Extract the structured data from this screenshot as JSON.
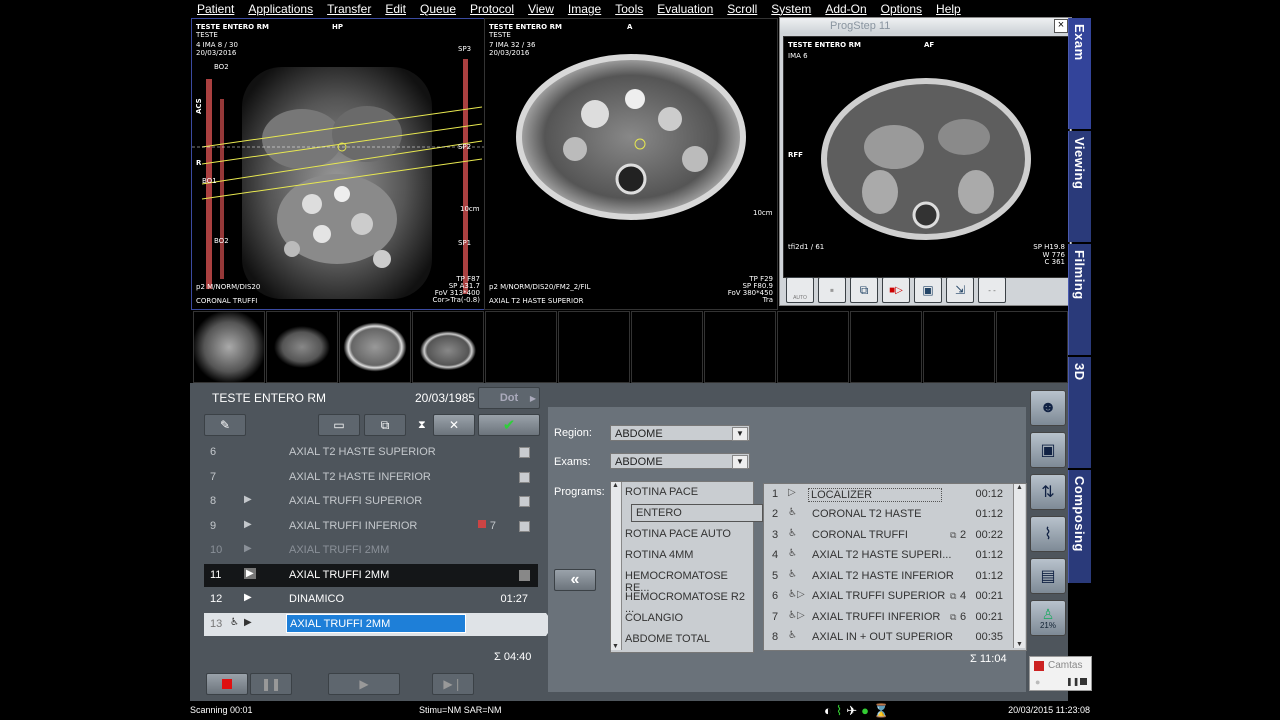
{
  "menu": [
    "Patient",
    "Applications",
    "Transfer",
    "Edit",
    "Queue",
    "Protocol",
    "View",
    "Image",
    "Tools",
    "Evaluation",
    "Scroll",
    "System",
    "Add-On",
    "Options",
    "Help"
  ],
  "viewport1": {
    "title": "TESTE ENTERO RM",
    "line2": "TESTE",
    "line3": "4 IMA 8 / 30",
    "line4": "20/03/2016",
    "top_center": "HP",
    "left_acs": "ACS",
    "bo2_top": "BO2",
    "bo1": "BO1",
    "bo2_bottom": "BO2",
    "r_label": "R",
    "sp3": "SP3",
    "sp2": "SP2",
    "sp1": "SP1",
    "scale": "10cm",
    "bl1": "p2 M/NORM/DIS20",
    "bl2": "CORONAL TRUFFI",
    "br1": "TP F87",
    "br2": "SP A31.7",
    "br3": "FoV 313*400",
    "br4": "Cor>Tra(-0.8)"
  },
  "viewport2": {
    "title": "TESTE ENTERO RM",
    "line2": "TESTE",
    "line3": "7 IMA 32 / 36",
    "line4": "20/03/2016",
    "top_center": "A",
    "scale": "10cm",
    "bl1": "p2 M/NORM/DIS20/FM2_2/FIL",
    "bl2": "AXIAL T2 HASTE SUPERIOR",
    "br1": "TP F29",
    "br2": "SP F80.9",
    "br3": "FoV 380*450",
    "br4": "Tra"
  },
  "progstep": {
    "window_title": "ProgStep  11",
    "title": "TESTE ENTERO RM",
    "line2": "IMA 6",
    "top_center": "AF",
    "rff": "RFF",
    "bottom_left": "tfi2d1 / 61",
    "sp": "SP H19.8",
    "w": "W 776",
    "c": "C 361",
    "auto_label": "AUTO",
    "close": "×"
  },
  "vtabs": [
    "Exam",
    "Viewing",
    "Filming",
    "3D",
    "Composing"
  ],
  "queue": {
    "patient_name": "TESTE ENTERO RM",
    "birth_date": "20/03/1985",
    "dot_label": "Dot",
    "total": "Σ 04:40",
    "rows": [
      {
        "num": "6",
        "play": "",
        "name": "AXIAL T2 HASTE SUPERIOR",
        "time": "",
        "indicator": true,
        "extra": ""
      },
      {
        "num": "7",
        "play": "",
        "name": "AXIAL T2 HASTE INFERIOR",
        "time": "",
        "indicator": true,
        "extra": ""
      },
      {
        "num": "8",
        "play": "▶",
        "name": "AXIAL TRUFFI SUPERIOR",
        "time": "",
        "indicator": true,
        "extra": ""
      },
      {
        "num": "9",
        "play": "▶",
        "name": "AXIAL TRUFFI INFERIOR",
        "time": "",
        "indicator": true,
        "extra": "7"
      },
      {
        "num": "10",
        "play": "▶",
        "name": "AXIAL TRUFFI 2MM",
        "time": "",
        "indicator": false,
        "extra": ""
      },
      {
        "num": "11",
        "play": "▶",
        "name": "AXIAL TRUFFI 2MM",
        "time": "",
        "indicator": true,
        "extra": ""
      },
      {
        "num": "12",
        "play": "▶",
        "name": "DINAMICO",
        "time": "01:27",
        "indicator": false,
        "extra": ""
      },
      {
        "num": "13",
        "play": "▶",
        "name": "AXIAL TRUFFI 2MM",
        "time": "",
        "indicator": false,
        "extra": ""
      }
    ]
  },
  "protocol": {
    "region_label": "Region:",
    "region_value": "ABDOME",
    "exams_label": "Exams:",
    "exams_value": "ABDOME",
    "programs_label": "Programs:",
    "programs": [
      "ROTINA PACE",
      "ENTERO",
      "ROTINA PACE AUTO",
      "ROTINA 4MM",
      "HEMOCROMATOSE RE...",
      "HEMOCROMATOSE R2 ...",
      "COLANGIO",
      "ABDOME TOTAL"
    ],
    "transfer_label": "«",
    "steps": [
      {
        "n": "1",
        "name": "LOCALIZER",
        "time": "00:12",
        "extra": ""
      },
      {
        "n": "2",
        "name": "CORONAL T2 HASTE",
        "time": "01:12",
        "extra": ""
      },
      {
        "n": "3",
        "name": "CORONAL TRUFFI",
        "time": "00:22",
        "extra": "2"
      },
      {
        "n": "4",
        "name": "AXIAL T2 HASTE SUPERI...",
        "time": "01:12",
        "extra": ""
      },
      {
        "n": "5",
        "name": "AXIAL T2 HASTE INFERIOR",
        "time": "01:12",
        "extra": ""
      },
      {
        "n": "6",
        "name": "AXIAL TRUFFI SUPERIOR",
        "time": "00:21",
        "extra": "4"
      },
      {
        "n": "7",
        "name": "AXIAL TRUFFI INFERIOR",
        "time": "00:21",
        "extra": "6"
      },
      {
        "n": "8",
        "name": "AXIAL IN + OUT SUPERIOR",
        "time": "00:35",
        "extra": ""
      }
    ],
    "total": "Σ 11:04"
  },
  "side": {
    "percent": "21%"
  },
  "camtasia": "Camtas",
  "status": {
    "scanning": "Scanning 00:01",
    "stimu": "Stimu=NM SAR=NM",
    "datetime": "20/03/2015 11:23:08"
  },
  "colors": {
    "accent": "#2a3a7a",
    "panel": "#4e555c",
    "selection": "#1e7fd8"
  }
}
